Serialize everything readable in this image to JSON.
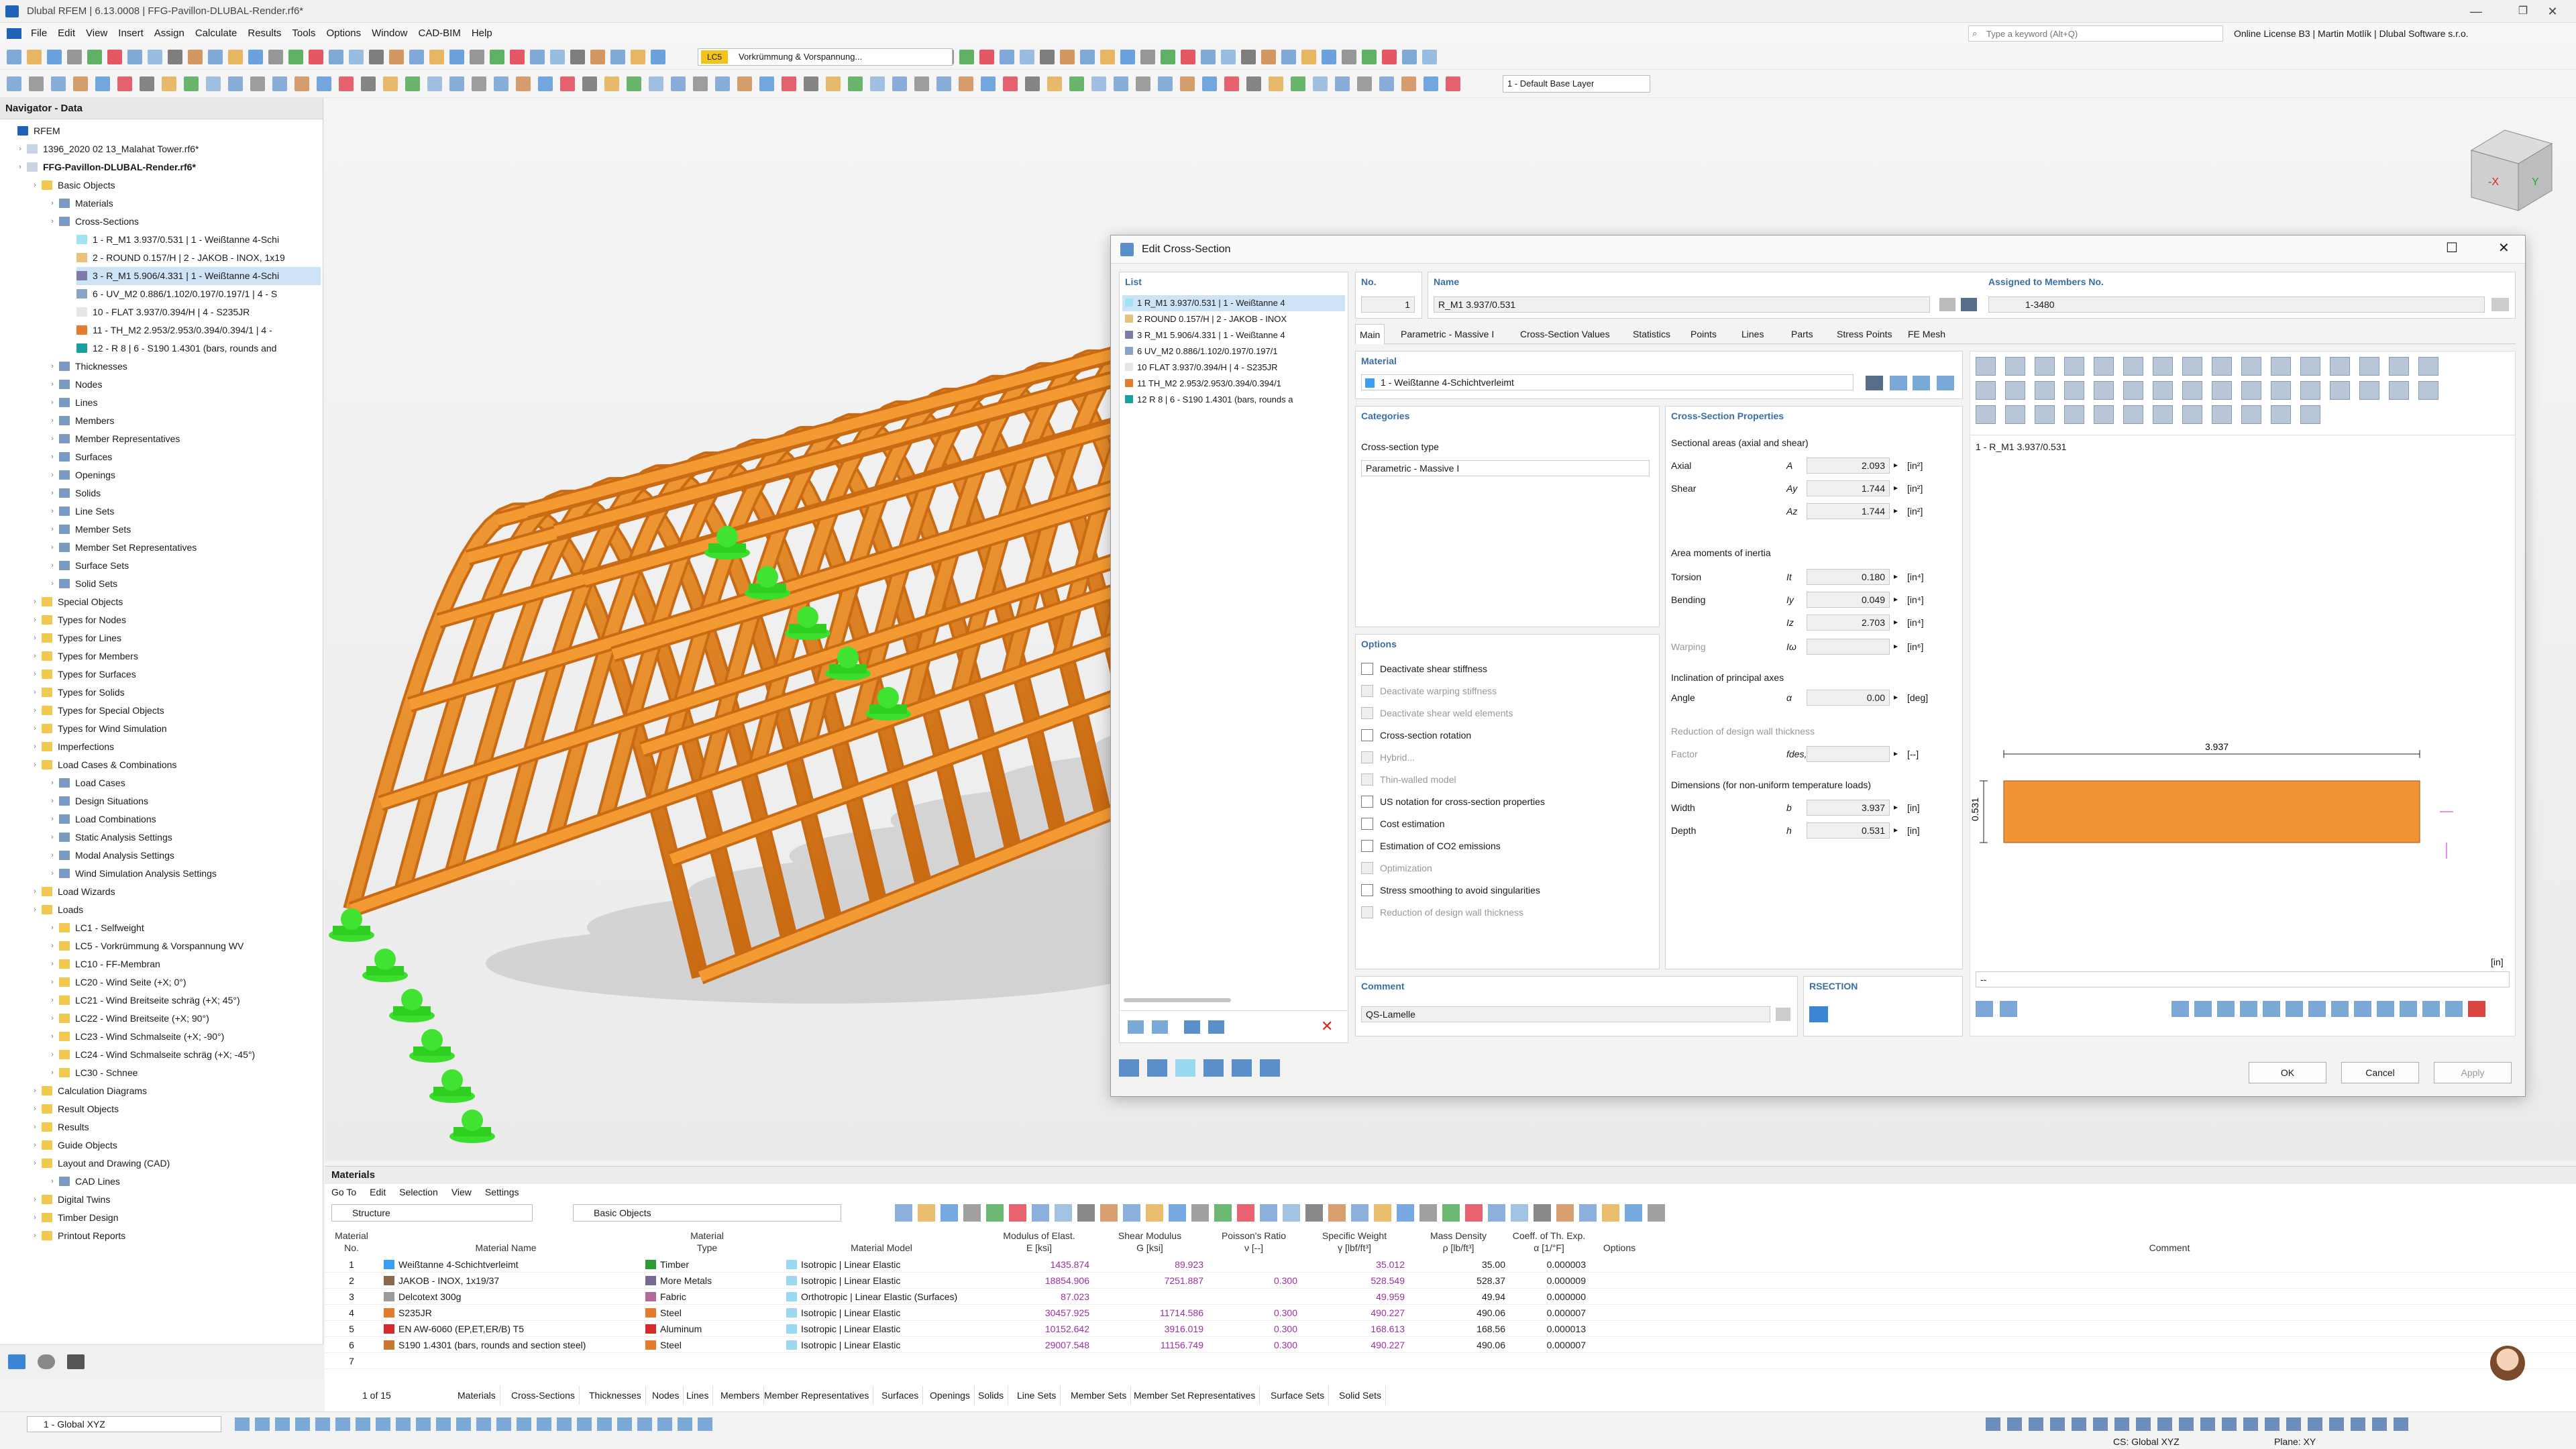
{
  "window": {
    "title": "Dlubal RFEM | 6.13.0008 | FFG-Pavillon-DLUBAL-Render.rf6*",
    "minimize": "—",
    "maximize": "❐",
    "close": "✕"
  },
  "menu": [
    "File",
    "Edit",
    "View",
    "Insert",
    "Assign",
    "Calculate",
    "Results",
    "Tools",
    "Options",
    "Window",
    "CAD-BIM",
    "Help"
  ],
  "search": {
    "placeholder": "Type a keyword (Alt+Q)"
  },
  "license": "Online License B3 | Martin Motlík | Dlubal Software s.r.o.",
  "toolbar": {
    "lc_badge": "LC5",
    "load_case": "Vorkrümmung & Vorspannung...",
    "layer": "1 - Default Base Layer"
  },
  "navigator": {
    "title": "Navigator - Data",
    "items": [
      {
        "label": "RFEM",
        "level": 0,
        "icon": "rfem-icon"
      },
      {
        "label": "1396_2020 02 13_Malahat Tower.rf6*",
        "level": 1,
        "icon": "file-icon"
      },
      {
        "label": "FFG-Pavillon-DLUBAL-Render.rf6*",
        "level": 1,
        "icon": "file-icon",
        "bold": true
      },
      {
        "label": "Basic Objects",
        "level": 2,
        "icon": "folder-icon"
      },
      {
        "label": "Materials",
        "level": 3,
        "icon": "materials-icon"
      },
      {
        "label": "Cross-Sections",
        "level": 3,
        "icon": "cross-sections-icon"
      },
      {
        "label": "1 - R_M1 3.937/0.531 | 1 - Weißtanne 4-Schi",
        "level": 4,
        "color": "#9fe3f4"
      },
      {
        "label": "2 - ROUND 0.157/H | 2 - JAKOB - INOX, 1x19",
        "level": 4,
        "color": "#e8c27a"
      },
      {
        "label": "3 - R_M1 5.906/4.331 | 1 - Weißtanne 4-Schi",
        "level": 4,
        "color": "#7c7ca8",
        "selected": true
      },
      {
        "label": "6 - UV_M2 0.886/1.102/0.197/0.197/1 | 4 - S",
        "level": 4,
        "color": "#8aa1c8"
      },
      {
        "label": "10 - FLAT 3.937/0.394/H | 4 - S235JR",
        "level": 4,
        "color": "#e6e6e6"
      },
      {
        "label": "11 - TH_M2 2.953/2.953/0.394/0.394/1 | 4 -",
        "level": 4,
        "color": "#e57b2d"
      },
      {
        "label": "12 - R 8 | 6 - S190 1.4301 (bars, rounds and",
        "level": 4,
        "color": "#17a0a0"
      },
      {
        "label": "Thicknesses",
        "level": 3,
        "icon": "thickness-icon"
      },
      {
        "label": "Nodes",
        "level": 3,
        "icon": "nodes-icon"
      },
      {
        "label": "Lines",
        "level": 3,
        "icon": "lines-icon"
      },
      {
        "label": "Members",
        "level": 3,
        "icon": "members-icon"
      },
      {
        "label": "Member Representatives",
        "level": 3,
        "icon": "member-rep-icon"
      },
      {
        "label": "Surfaces",
        "level": 3,
        "icon": "surfaces-icon"
      },
      {
        "label": "Openings",
        "level": 3,
        "icon": "openings-icon"
      },
      {
        "label": "Solids",
        "level": 3,
        "icon": "solids-icon"
      },
      {
        "label": "Line Sets",
        "level": 3,
        "icon": "line-sets-icon"
      },
      {
        "label": "Member Sets",
        "level": 3,
        "icon": "member-sets-icon"
      },
      {
        "label": "Member Set Representatives",
        "level": 3,
        "icon": "member-set-rep-icon"
      },
      {
        "label": "Surface Sets",
        "level": 3,
        "icon": "surface-sets-icon"
      },
      {
        "label": "Solid Sets",
        "level": 3,
        "icon": "solid-sets-icon"
      },
      {
        "label": "Special Objects",
        "level": 2,
        "icon": "folder-icon"
      },
      {
        "label": "Types for Nodes",
        "level": 2,
        "icon": "folder-icon"
      },
      {
        "label": "Types for Lines",
        "level": 2,
        "icon": "folder-icon"
      },
      {
        "label": "Types for Members",
        "level": 2,
        "icon": "folder-icon"
      },
      {
        "label": "Types for Surfaces",
        "level": 2,
        "icon": "folder-icon"
      },
      {
        "label": "Types for Solids",
        "level": 2,
        "icon": "folder-icon"
      },
      {
        "label": "Types for Special Objects",
        "level": 2,
        "icon": "folder-icon"
      },
      {
        "label": "Types for Wind Simulation",
        "level": 2,
        "icon": "folder-icon"
      },
      {
        "label": "Imperfections",
        "level": 2,
        "icon": "folder-icon"
      },
      {
        "label": "Load Cases & Combinations",
        "level": 2,
        "icon": "folder-icon"
      },
      {
        "label": "Load Cases",
        "level": 3,
        "icon": "load-cases-icon"
      },
      {
        "label": "Design Situations",
        "level": 3,
        "icon": "design-situations-icon"
      },
      {
        "label": "Load Combinations",
        "level": 3,
        "icon": "load-combinations-icon"
      },
      {
        "label": "Static Analysis Settings",
        "level": 3,
        "icon": "static-settings-icon"
      },
      {
        "label": "Modal Analysis Settings",
        "level": 3,
        "icon": "modal-settings-icon"
      },
      {
        "label": "Wind Simulation Analysis Settings",
        "level": 3,
        "icon": "wind-settings-icon"
      },
      {
        "label": "Load Wizards",
        "level": 2,
        "icon": "folder-icon"
      },
      {
        "label": "Loads",
        "level": 2,
        "icon": "folder-icon"
      },
      {
        "label": "LC1 - Selfweight",
        "level": 3,
        "icon": "folder-icon"
      },
      {
        "label": "LC5 - Vorkrümmung & Vorspannung WV",
        "level": 3,
        "icon": "folder-icon"
      },
      {
        "label": "LC10 - FF-Membran",
        "level": 3,
        "icon": "folder-icon"
      },
      {
        "label": "LC20 - Wind Seite (+X; 0°)",
        "level": 3,
        "icon": "folder-icon"
      },
      {
        "label": "LC21 - Wind Breitseite schräg (+X; 45°)",
        "level": 3,
        "icon": "folder-icon"
      },
      {
        "label": "LC22 - Wind Breitseite (+X; 90°)",
        "level": 3,
        "icon": "folder-icon"
      },
      {
        "label": "LC23 - Wind Schmalseite (+X; -90°)",
        "level": 3,
        "icon": "folder-icon"
      },
      {
        "label": "LC24 - Wind Schmalseite schräg (+X; -45°)",
        "level": 3,
        "icon": "folder-icon"
      },
      {
        "label": "LC30 - Schnee",
        "level": 3,
        "icon": "folder-icon"
      },
      {
        "label": "Calculation Diagrams",
        "level": 2,
        "icon": "folder-icon"
      },
      {
        "label": "Result Objects",
        "level": 2,
        "icon": "folder-icon"
      },
      {
        "label": "Results",
        "level": 2,
        "icon": "folder-icon"
      },
      {
        "label": "Guide Objects",
        "level": 2,
        "icon": "folder-icon"
      },
      {
        "label": "Layout and Drawing (CAD)",
        "level": 2,
        "icon": "folder-icon"
      },
      {
        "label": "CAD Lines",
        "level": 3,
        "icon": "cad-lines-icon"
      },
      {
        "label": "Digital Twins",
        "level": 2,
        "icon": "folder-icon"
      },
      {
        "label": "Timber Design",
        "level": 2,
        "icon": "folder-icon"
      },
      {
        "label": "Printout Reports",
        "level": 2,
        "icon": "folder-icon"
      }
    ]
  },
  "dialog": {
    "title": "Edit Cross-Section",
    "list_header": "List",
    "list": [
      {
        "text": "1 R_M1 3.937/0.531 | 1 - Weißtanne 4",
        "color": "#9fe3f4",
        "selected": true
      },
      {
        "text": "2 ROUND 0.157/H | 2 - JAKOB - INOX",
        "color": "#e8c27a"
      },
      {
        "text": "3 R_M1 5.906/4.331 | 1 - Weißtanne 4",
        "color": "#7c7ca8"
      },
      {
        "text": "6 UV_M2 0.886/1.102/0.197/0.197/1",
        "color": "#8aa1c8"
      },
      {
        "text": "10 FLAT 3.937/0.394/H | 4 - S235JR",
        "color": "#e6e6e6"
      },
      {
        "text": "11 TH_M2 2.953/2.953/0.394/0.394/1",
        "color": "#e57b2d"
      },
      {
        "text": "12 R 8 | 6 - S190 1.4301 (bars, rounds a",
        "color": "#17a0a0"
      }
    ],
    "no_label": "No.",
    "no_value": "1",
    "name_label": "Name",
    "name_value": "R_M1 3.937/0.531",
    "assigned_label": "Assigned to Members No.",
    "assigned_value": "1-3480",
    "tabs": [
      "Main",
      "Parametric - Massive I",
      "Cross-Section Values",
      "Statistics",
      "Points",
      "Lines",
      "Parts",
      "Stress Points",
      "FE Mesh"
    ],
    "material_label": "Material",
    "material_value": "1 - Weißtanne 4-Schichtverleimt",
    "categories_label": "Categories",
    "cs_type_label": "Cross-section type",
    "cs_type_value": "Parametric - Massive I",
    "props_label": "Cross-Section Properties",
    "sectional_label": "Sectional areas (axial and shear)",
    "axial": {
      "label": "Axial",
      "sym": "A",
      "val": "2.093",
      "unit": "[in²]"
    },
    "shear": {
      "label": "Shear",
      "sym": "Ay",
      "val": "1.744",
      "unit": "[in²]"
    },
    "shear_z": {
      "sym": "Az",
      "val": "1.744",
      "unit": "[in²]"
    },
    "moments_label": "Area moments of inertia",
    "torsion": {
      "label": "Torsion",
      "sym": "It",
      "val": "0.180",
      "unit": "[in⁴]"
    },
    "bending": {
      "label": "Bending",
      "sym": "Iy",
      "val": "0.049",
      "unit": "[in⁴]"
    },
    "bending_z": {
      "sym": "Iz",
      "val": "2.703",
      "unit": "[in⁴]"
    },
    "warping": {
      "label": "Warping",
      "sym": "Iω",
      "val": "",
      "unit": "[in⁶]"
    },
    "incl_label": "Inclination of principal axes",
    "angle": {
      "label": "Angle",
      "sym": "α",
      "val": "0.00",
      "unit": "[deg]"
    },
    "reduction_label": "Reduction of design wall thickness",
    "factor": {
      "label": "Factor",
      "sym": "fdes,t",
      "val": "",
      "unit": "[--]"
    },
    "dims_label": "Dimensions (for non-uniform temperature loads)",
    "width": {
      "label": "Width",
      "sym": "b",
      "val": "3.937",
      "unit": "[in]"
    },
    "depth": {
      "label": "Depth",
      "sym": "h",
      "val": "0.531",
      "unit": "[in]"
    },
    "options_label": "Options",
    "options": [
      {
        "label": "Deactivate shear stiffness",
        "enabled": true
      },
      {
        "label": "Deactivate warping stiffness",
        "enabled": false
      },
      {
        "label": "Deactivate shear weld elements",
        "enabled": false
      },
      {
        "label": "Cross-section rotation",
        "enabled": true
      },
      {
        "label": "Hybrid...",
        "enabled": false
      },
      {
        "label": "Thin-walled model",
        "enabled": false
      },
      {
        "label": "US notation for cross-section properties",
        "enabled": true
      },
      {
        "label": "Cost estimation",
        "enabled": true
      },
      {
        "label": "Estimation of CO2 emissions",
        "enabled": true
      },
      {
        "label": "Optimization",
        "enabled": false
      },
      {
        "label": "Stress smoothing to avoid singularities",
        "enabled": true
      },
      {
        "label": "Reduction of design wall thickness",
        "enabled": false
      }
    ],
    "comment_label": "Comment",
    "comment_value": "QS-Lamelle",
    "rsection_label": "RSECTION",
    "preview_title": "1 - R_M1 3.937/0.531",
    "preview_width_dim": "3.937",
    "preview_depth_dim": "0.531",
    "preview_unit": "[in]",
    "preview_combo": "--",
    "ok": "OK",
    "cancel": "Cancel",
    "apply": "Apply"
  },
  "materials_panel": {
    "title": "Materials",
    "menu": [
      "Go To",
      "Edit",
      "Selection",
      "View",
      "Settings"
    ],
    "filter": "Structure",
    "filter2": "Basic Objects",
    "headers": [
      [
        "Material",
        "No."
      ],
      [
        "",
        "Material Name"
      ],
      [
        "Material",
        "Type"
      ],
      [
        "",
        "Material Model"
      ],
      [
        "Modulus of Elast.",
        "E [ksi]"
      ],
      [
        "Shear Modulus",
        "G [ksi]"
      ],
      [
        "Poisson's Ratio",
        "ν [--]"
      ],
      [
        "Specific Weight",
        "γ [lbf/ft³]"
      ],
      [
        "Mass Density",
        "ρ [lb/ft³]"
      ],
      [
        "Coeff. of Th. Exp.",
        "α [1/°F]"
      ],
      [
        "",
        "Options"
      ],
      [
        "",
        "Comment"
      ]
    ],
    "rows": [
      {
        "no": "1",
        "name": "Weißtanne 4-Schichtverleimt",
        "name_color": "#3b9ef0",
        "type": "Timber",
        "type_color": "#2e9a35",
        "model": "Isotropic | Linear Elastic",
        "E": "1435.874",
        "G": "89.923",
        "nu": "",
        "gamma": "35.012",
        "rho": "35.00",
        "alpha": "0.000003"
      },
      {
        "no": "2",
        "name": "JAKOB - INOX, 1x19/37",
        "name_color": "#8a6a4a",
        "type": "More Metals",
        "type_color": "#7a6a90",
        "model": "Isotropic | Linear Elastic",
        "E": "18854.906",
        "G": "7251.887",
        "nu": "0.300",
        "gamma": "528.549",
        "rho": "528.37",
        "alpha": "0.000009"
      },
      {
        "no": "3",
        "name": "Delcotext 300g",
        "name_color": "#9c9c9c",
        "type": "Fabric",
        "type_color": "#b06a9b",
        "model": "Orthotropic | Linear Elastic (Surfaces)",
        "E": "87.023",
        "G": "",
        "nu": "",
        "gamma": "49.959",
        "rho": "49.94",
        "alpha": "0.000000"
      },
      {
        "no": "4",
        "name": "S235JR",
        "name_color": "#e57b2d",
        "type": "Steel",
        "type_color": "#e57b2d",
        "model": "Isotropic | Linear Elastic",
        "E": "30457.925",
        "G": "11714.586",
        "nu": "0.300",
        "gamma": "490.227",
        "rho": "490.06",
        "alpha": "0.000007"
      },
      {
        "no": "5",
        "name": "EN AW-6060 (EP,ET,ER/B) T5",
        "name_color": "#d42a2a",
        "type": "Aluminum",
        "type_color": "#d42a2a",
        "model": "Isotropic | Linear Elastic",
        "E": "10152.642",
        "G": "3916.019",
        "nu": "0.300",
        "gamma": "168.613",
        "rho": "168.56",
        "alpha": "0.000013"
      },
      {
        "no": "6",
        "name": "S190 1.4301 (bars, rounds and section steel)",
        "name_color": "#c77830",
        "type": "Steel",
        "type_color": "#e57b2d",
        "model": "Isotropic | Linear Elastic",
        "E": "29007.548",
        "G": "11156.749",
        "nu": "0.300",
        "gamma": "490.227",
        "rho": "490.06",
        "alpha": "0.000007"
      },
      {
        "no": "7",
        "name": "",
        "name_color": "",
        "type": "",
        "type_color": "",
        "model": "",
        "E": "",
        "G": "",
        "nu": "",
        "gamma": "",
        "rho": "",
        "alpha": ""
      }
    ],
    "pager": "1 of 15",
    "tabs": [
      "Materials",
      "Cross-Sections",
      "Thicknesses",
      "Nodes",
      "Lines",
      "Members",
      "Member Representatives",
      "Surfaces",
      "Openings",
      "Solids",
      "Line Sets",
      "Member Sets",
      "Member Set Representatives",
      "Surface Sets",
      "Solid Sets"
    ]
  },
  "status": {
    "cs": "1 - Global XYZ",
    "cs_status": "CS: Global XYZ",
    "plane": "Plane: XY"
  }
}
